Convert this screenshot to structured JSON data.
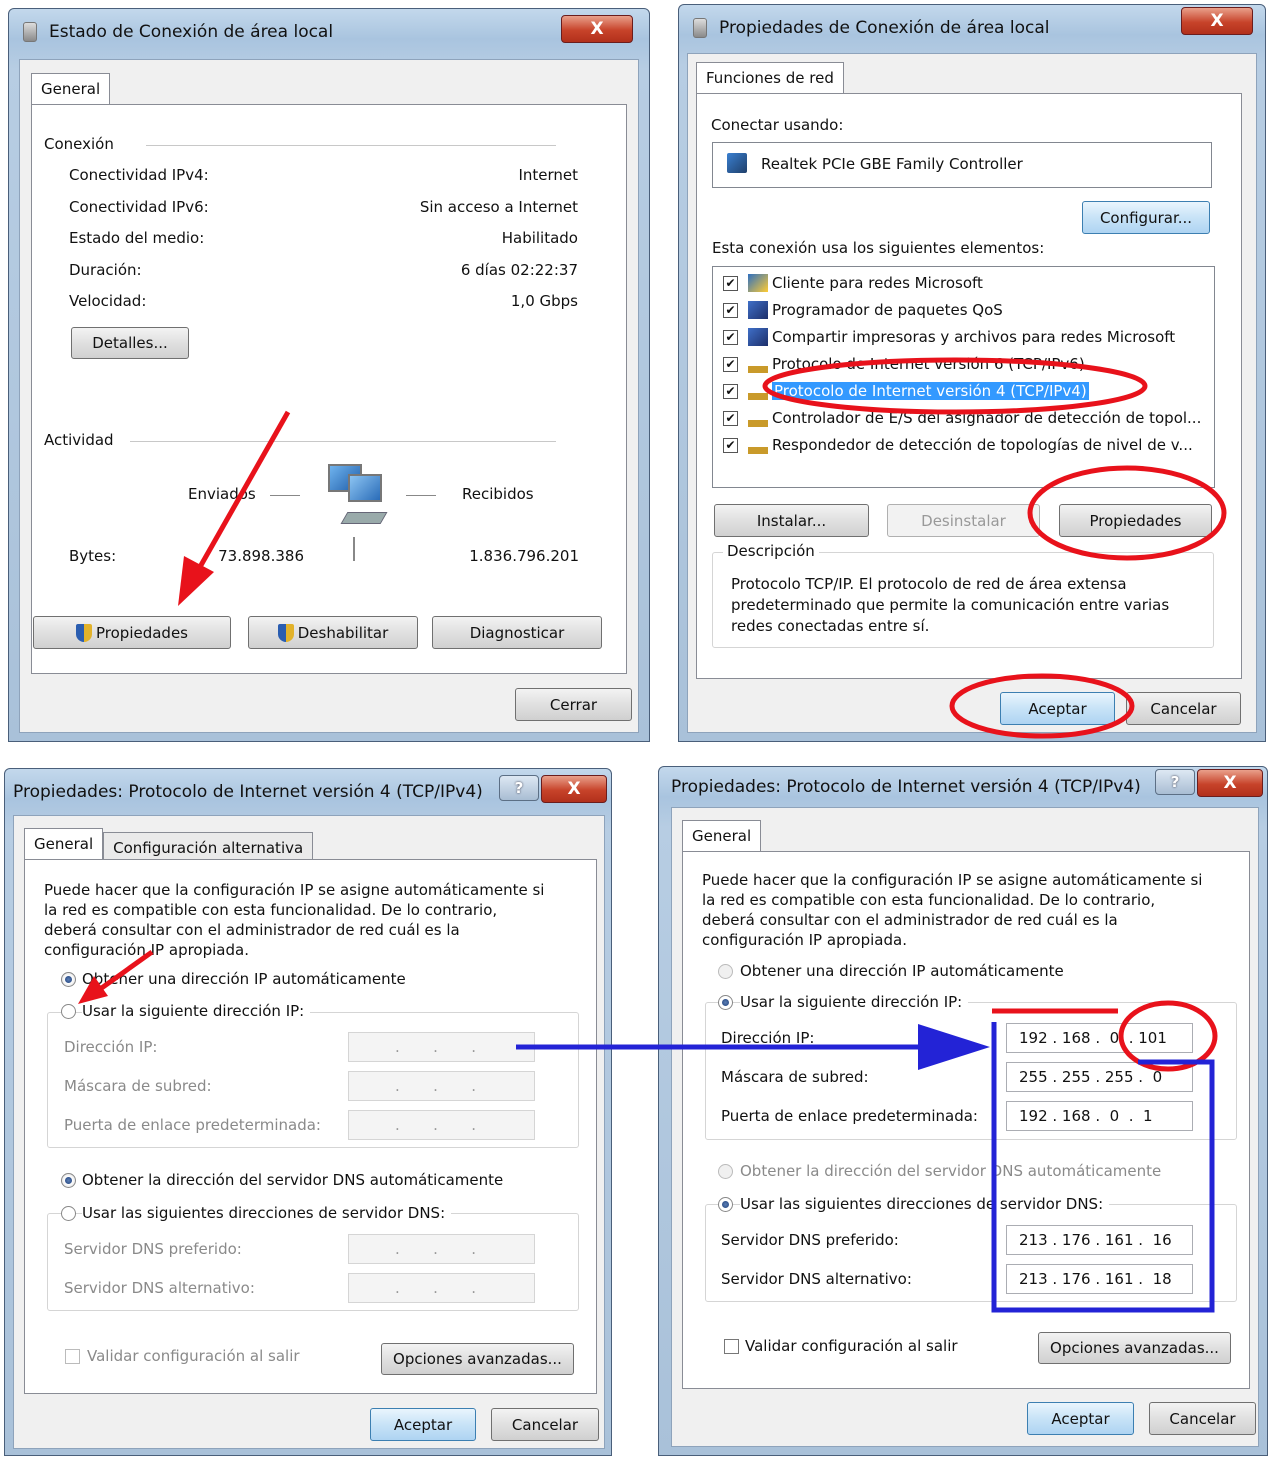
{
  "w1": {
    "title": "Estado de Conexión de área local",
    "close": "X",
    "tab": "General",
    "section_connection": "Conexión",
    "rows": [
      {
        "label": "Conectividad IPv4:",
        "value": "Internet"
      },
      {
        "label": "Conectividad IPv6:",
        "value": "Sin acceso a Internet"
      },
      {
        "label": "Estado del medio:",
        "value": "Habilitado"
      },
      {
        "label": "Duración:",
        "value": "6 días 02:22:37"
      },
      {
        "label": "Velocidad:",
        "value": "1,0 Gbps"
      }
    ],
    "details_button": "Detalles...",
    "section_activity": "Actividad",
    "sent_label": "Enviados",
    "received_label": "Recibidos",
    "bytes_label": "Bytes:",
    "bytes_sent": "73.898.386",
    "bytes_received": "1.836.796.201",
    "properties_button": "Propiedades",
    "disable_button": "Deshabilitar",
    "diagnose_button": "Diagnosticar",
    "close_button": "Cerrar"
  },
  "w2": {
    "title": "Propiedades de Conexión de área local",
    "close": "X",
    "tab": "Funciones de red",
    "connect_using": "Conectar usando:",
    "adapter": "Realtek PCIe GBE Family Controller",
    "configure_button": "Configurar...",
    "items_label": "Esta conexión usa los siguientes elementos:",
    "items": [
      "Cliente para redes Microsoft",
      "Programador de paquetes QoS",
      "Compartir impresoras y archivos para redes Microsoft",
      "Protocolo de Internet versión 6 (TCP/IPv6)",
      "Protocolo de Internet versión 4 (TCP/IPv4)",
      "Controlador de E/S del asignador de detección de topol...",
      "Respondedor de detección de topologías de nivel de v..."
    ],
    "install_button": "Instalar...",
    "uninstall_button": "Desinstalar",
    "properties_button": "Propiedades",
    "description_label": "Descripción",
    "description_text": "Protocolo TCP/IP. El protocolo de red de área extensa predeterminado que permite la comunicación entre varias redes conectadas entre sí.",
    "ok_button": "Aceptar",
    "cancel_button": "Cancelar"
  },
  "w3": {
    "title": "Propiedades: Protocolo de Internet versión 4 (TCP/IPv4)",
    "help": "?",
    "close": "X",
    "tab_general": "General",
    "tab_alt": "Configuración alternativa",
    "intro": "Puede hacer que la configuración IP se asigne automáticamente si la red es compatible con esta funcionalidad. De lo contrario, deberá consultar con el administrador de red cuál es la configuración IP apropiada.",
    "auto_ip": "Obtener una dirección IP automáticamente",
    "manual_ip": "Usar la siguiente dirección IP:",
    "ip_label": "Dirección IP:",
    "mask_label": "Máscara de subred:",
    "gateway_label": "Puerta de enlace predeterminada:",
    "empty_ip": ".       .       .",
    "auto_dns": "Obtener la dirección del servidor DNS automáticamente",
    "manual_dns": "Usar las siguientes direcciones de servidor DNS:",
    "dns_pref_label": "Servidor DNS preferido:",
    "dns_alt_label": "Servidor DNS alternativo:",
    "validate": "Validar configuración al salir",
    "advanced_button": "Opciones avanzadas...",
    "ok_button": "Aceptar",
    "cancel_button": "Cancelar"
  },
  "w4": {
    "title": "Propiedades: Protocolo de Internet versión 4 (TCP/IPv4)",
    "help": "?",
    "close": "X",
    "tab_general": "General",
    "intro": "Puede hacer que la configuración IP se asigne automáticamente si la red es compatible con esta funcionalidad. De lo contrario, deberá consultar con el administrador de red cuál es la configuración IP apropiada.",
    "auto_ip": "Obtener una dirección IP automáticamente",
    "manual_ip": "Usar la siguiente dirección IP:",
    "ip_label": "Dirección IP:",
    "ip_value": "192 . 168 .  0  . 101",
    "mask_label": "Máscara de subred:",
    "mask_value": "255 . 255 . 255 .  0",
    "gateway_label": "Puerta de enlace predeterminada:",
    "gateway_value": "192 . 168 .  0  .  1",
    "auto_dns": "Obtener la dirección del servidor DNS automáticamente",
    "manual_dns": "Usar las siguientes direcciones de servidor DNS:",
    "dns_pref_label": "Servidor DNS preferido:",
    "dns_pref_value": "213 . 176 . 161 .  16",
    "dns_alt_label": "Servidor DNS alternativo:",
    "dns_alt_value": "213 . 176 . 161 .  18",
    "validate": "Validar configuración al salir",
    "advanced_button": "Opciones avanzadas...",
    "ok_button": "Aceptar",
    "cancel_button": "Cancelar"
  },
  "colors": {
    "annotation_red": "#e8121b",
    "annotation_blue": "#2323d6",
    "selection": "#3399ff"
  }
}
